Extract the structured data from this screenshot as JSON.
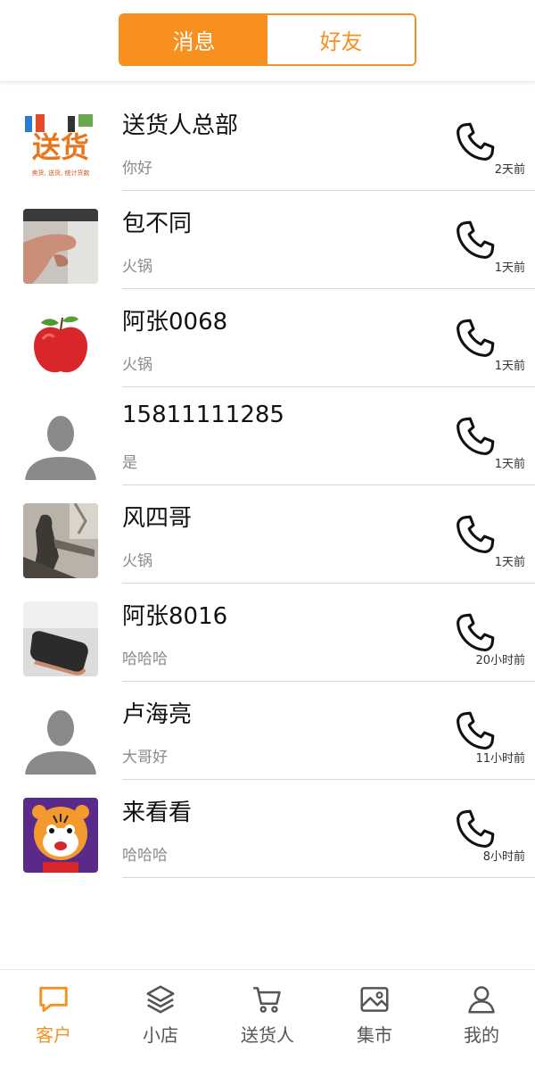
{
  "header": {
    "segments": [
      {
        "label": "消息",
        "active": true
      },
      {
        "label": "好友",
        "active": false
      }
    ],
    "accent_color": "#f7901e"
  },
  "contacts": [
    {
      "name": "送货人总部",
      "preview": "你好",
      "time": "2天前",
      "avatar": "logo",
      "logo_text": "送货",
      "logo_caption": "卖货, 送货, 统计货款"
    },
    {
      "name": "包不同",
      "preview": "火锅",
      "time": "1天前",
      "avatar": "hand-photo"
    },
    {
      "name": "阿张0068",
      "preview": "火锅",
      "time": "1天前",
      "avatar": "apple"
    },
    {
      "name": "15811111285",
      "preview": "是",
      "time": "1天前",
      "avatar": "default-person"
    },
    {
      "name": "风四哥",
      "preview": "火锅",
      "time": "1天前",
      "avatar": "shadow-photo"
    },
    {
      "name": "阿张8016",
      "preview": "哈哈哈",
      "time": "20小时前",
      "avatar": "speaker-photo"
    },
    {
      "name": "卢海亮",
      "preview": "大哥好",
      "time": "11小时前",
      "avatar": "default-person"
    },
    {
      "name": "来看看",
      "preview": "哈哈哈",
      "time": "8小时前",
      "avatar": "tiger-cartoon"
    }
  ],
  "tabbar": {
    "tabs": [
      {
        "label": "客户",
        "icon": "chat-icon",
        "active": true
      },
      {
        "label": "小店",
        "icon": "layers-icon",
        "active": false
      },
      {
        "label": "送货人",
        "icon": "cart-icon",
        "active": false
      },
      {
        "label": "集市",
        "icon": "image-icon",
        "active": false
      },
      {
        "label": "我的",
        "icon": "user-icon",
        "active": false
      }
    ]
  }
}
